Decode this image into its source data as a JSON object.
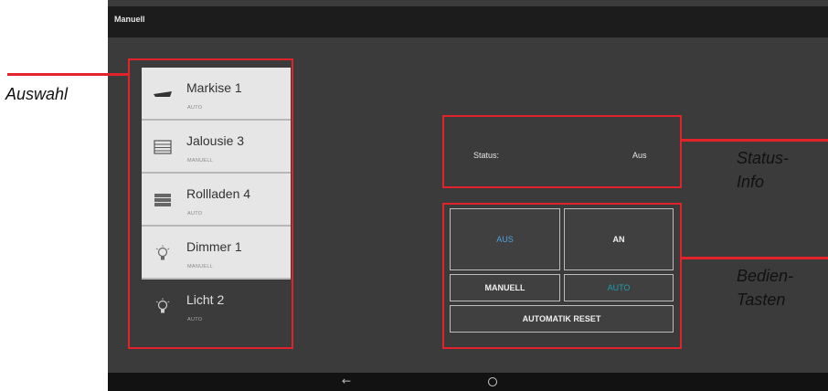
{
  "window": {
    "title": "Manuell"
  },
  "devices": [
    {
      "label": "Markise 1",
      "mode": "AUTO",
      "icon": "awning-icon",
      "selected": false
    },
    {
      "label": "Jalousie 3",
      "mode": "MANUELL",
      "icon": "blinds-icon",
      "selected": false
    },
    {
      "label": "Rollladen 4",
      "mode": "AUTO",
      "icon": "shutter-icon",
      "selected": false
    },
    {
      "label": "Dimmer 1",
      "mode": "MANUELL",
      "icon": "bulb-icon",
      "selected": false
    },
    {
      "label": "Licht 2",
      "mode": "AUTO",
      "icon": "bulb-icon",
      "selected": true
    }
  ],
  "status": {
    "title": "Status:",
    "value": "Aus"
  },
  "buttons": {
    "aus": "AUS",
    "an": "AN",
    "manuell": "MANUELL",
    "auto": "AUTO",
    "reset": "AUTOMATIK RESET"
  },
  "annotations": {
    "auswahl": "Auswahl",
    "status_line1": "Status-",
    "status_line2": "Info",
    "tasten_line1": "Bedien-",
    "tasten_line2": "Tasten"
  },
  "colors": {
    "annotation_red": "#e3232a",
    "aus_blue": "#4aa3df",
    "auto_teal": "#1a9fb0"
  }
}
